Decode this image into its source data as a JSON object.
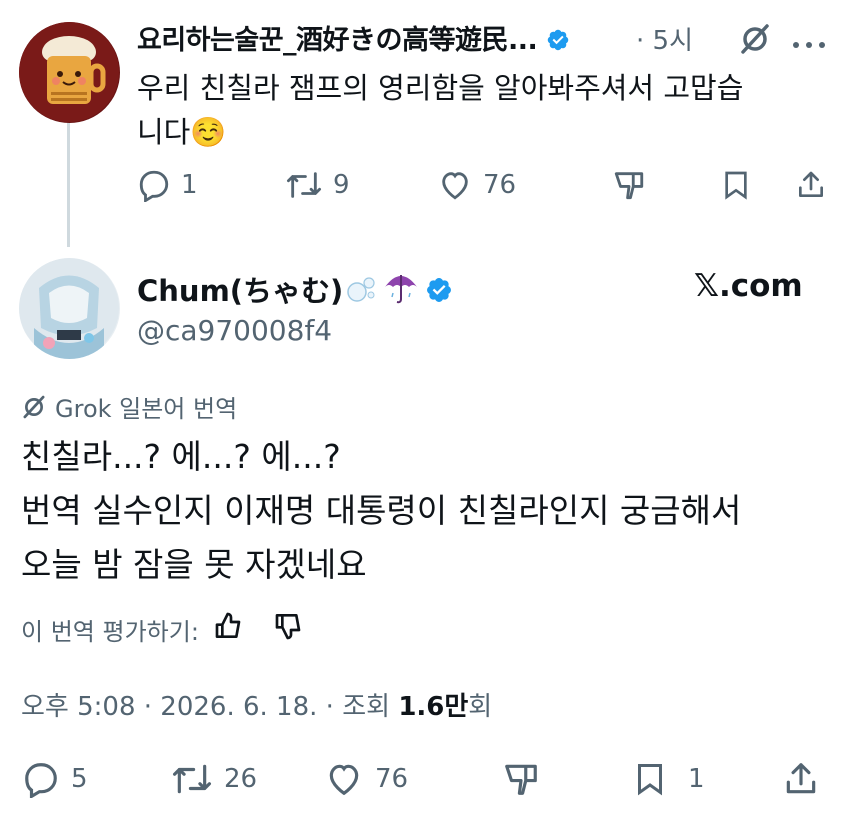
{
  "reply": {
    "display_name": "요리하는술꾼_酒好きの高等遊民...",
    "time": "· 5시",
    "text": "우리 친칠라 잼프의 영리함을 알아봐주셔서 고맙습니다☺️",
    "text_line1": "우리 친칠라 잼프의 영리함을 알아봐주셔서 고맙습",
    "text_line2": "니다☺️",
    "actions": {
      "replies": "1",
      "reposts": "9",
      "likes": "76"
    }
  },
  "main": {
    "display_name": "Chum(ちゃむ)🫧☔",
    "display_name_text": "Chum(ちゃむ)",
    "handle": "@ca970008f4",
    "watermark": "𝕏.com",
    "translation_label": "Grok 일본어 번역",
    "text_line1": "친칠라...? 에...? 에...?",
    "text_line2": "번역 실수인지 이재명 대통령이 친칠라인지 궁금해서",
    "text_line3": "오늘 밤 잠을 못 자겠네요",
    "rate_label": "이 번역 평가하기:",
    "timestamp": "오후 5:08 · 2026. 6. 18. · 조회 ",
    "views": "1.6만",
    "views_suffix": "회",
    "actions": {
      "replies": "5",
      "reposts": "26",
      "likes": "76",
      "bookmarks": "1"
    }
  },
  "colors": {
    "text": "#0f1419",
    "secondary": "#536471",
    "verified": "#1d9bf0",
    "thread_line": "#cfd9de"
  }
}
